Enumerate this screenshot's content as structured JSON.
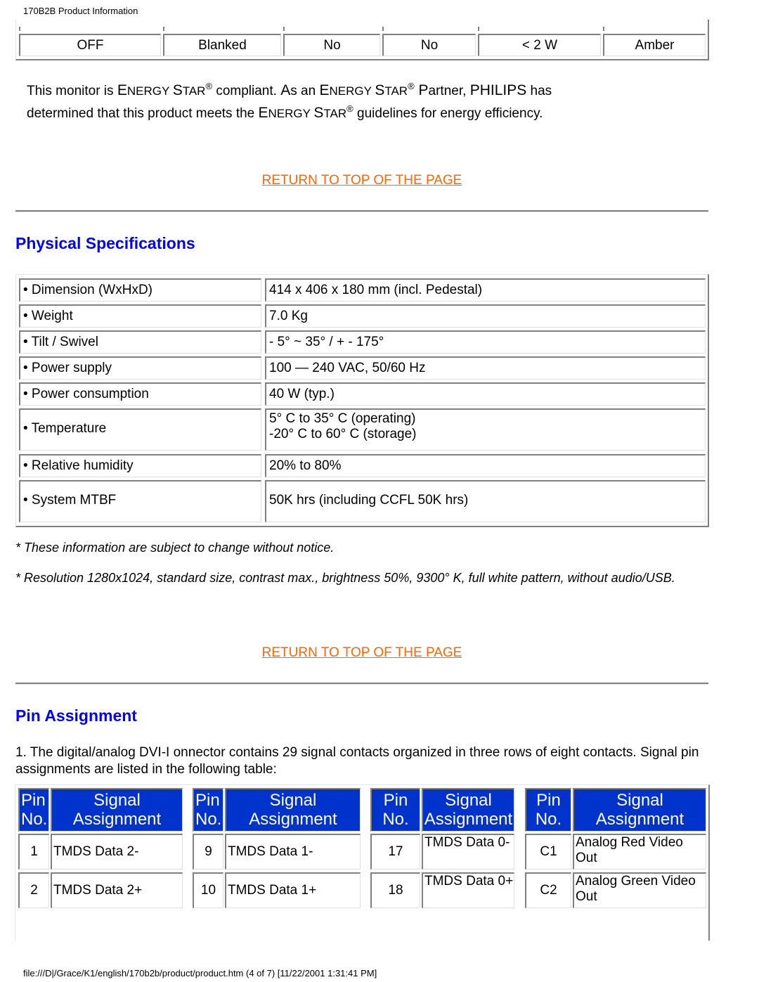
{
  "header": {
    "title": "170B2B Product Information"
  },
  "power_table": {
    "row": [
      "OFF",
      "Blanked",
      "No",
      "No",
      "< 2 W",
      "Amber"
    ]
  },
  "energy": {
    "line1_a": "This monitor is ",
    "es_E": "E",
    "es_NERGY": "NERGY ",
    "es_S": "S",
    "es_TAR": "TAR",
    "reg": "®",
    "line1_b": " compliant. ",
    "as_A": "A",
    "as_rest": "s an ",
    "partner_P": " P",
    "partner_rest": "artner, ",
    "philips": "PHILIPS",
    "line1_c": " has",
    "line2_a": "determined that this product meets the ",
    "line2_b": " guidelines for energy efficiency."
  },
  "links": {
    "return_top": "RETURN TO TOP OF THE PAGE"
  },
  "physical": {
    "title": "Physical Specifications",
    "rows": [
      {
        "label": "• Dimension (WxHxD)",
        "value": "414 x 406 x 180 mm (incl. Pedestal)"
      },
      {
        "label": "• Weight",
        "value": "7.0 Kg"
      },
      {
        "label": "• Tilt / Swivel",
        "value": "- 5° ~ 35° / + - 175°"
      },
      {
        "label": "• Power supply",
        "value": "100 — 240 VAC, 50/60 Hz"
      },
      {
        "label": "• Power consumption",
        "value": "40 W (typ.)"
      },
      {
        "label": "• Temperature",
        "value": "5° C to 35° C (operating)",
        "value2": "-20° C to 60° C (storage)"
      },
      {
        "label": "• Relative humidity",
        "value": "20% to 80%"
      },
      {
        "label": "• System MTBF",
        "value": "50K hrs (including CCFL 50K hrs)"
      }
    ],
    "note1": "* These information are subject to change without notice.",
    "note2": "* Resolution 1280x1024, standard size, contrast max., brightness 50%, 9300° K, full white pattern, without audio/USB."
  },
  "pin": {
    "title": "Pin Assignment",
    "intro": "1. The digital/analog DVI-I onnector contains 29 signal contacts organized in three rows of eight contacts. Signal pin assignments are listed in the following table:",
    "head_pin_1": "Pin",
    "head_pin_2": "No.",
    "head_sig_1": "Signal",
    "head_sig_2": "Assignment",
    "groups": [
      {
        "rows": [
          {
            "pin": "1",
            "signal": "TMDS Data 2-"
          },
          {
            "pin": "2",
            "signal": "TMDS Data 2+"
          }
        ]
      },
      {
        "rows": [
          {
            "pin": "9",
            "signal": "TMDS Data 1-"
          },
          {
            "pin": "10",
            "signal": "TMDS Data 1+"
          }
        ]
      },
      {
        "rows": [
          {
            "pin": "17",
            "signal": "TMDS Data 0-"
          },
          {
            "pin": "18",
            "signal": "TMDS Data 0+"
          }
        ]
      },
      {
        "rows": [
          {
            "pin": "C1",
            "signal": "Analog Red Video Out"
          },
          {
            "pin": "C2",
            "signal": "Analog Green Video Out"
          }
        ]
      }
    ]
  },
  "footer": {
    "text": "file:///D|/Grace/K1/english/170b2b/product/product.htm (4 of 7) [11/22/2001 1:31:41 PM]"
  }
}
